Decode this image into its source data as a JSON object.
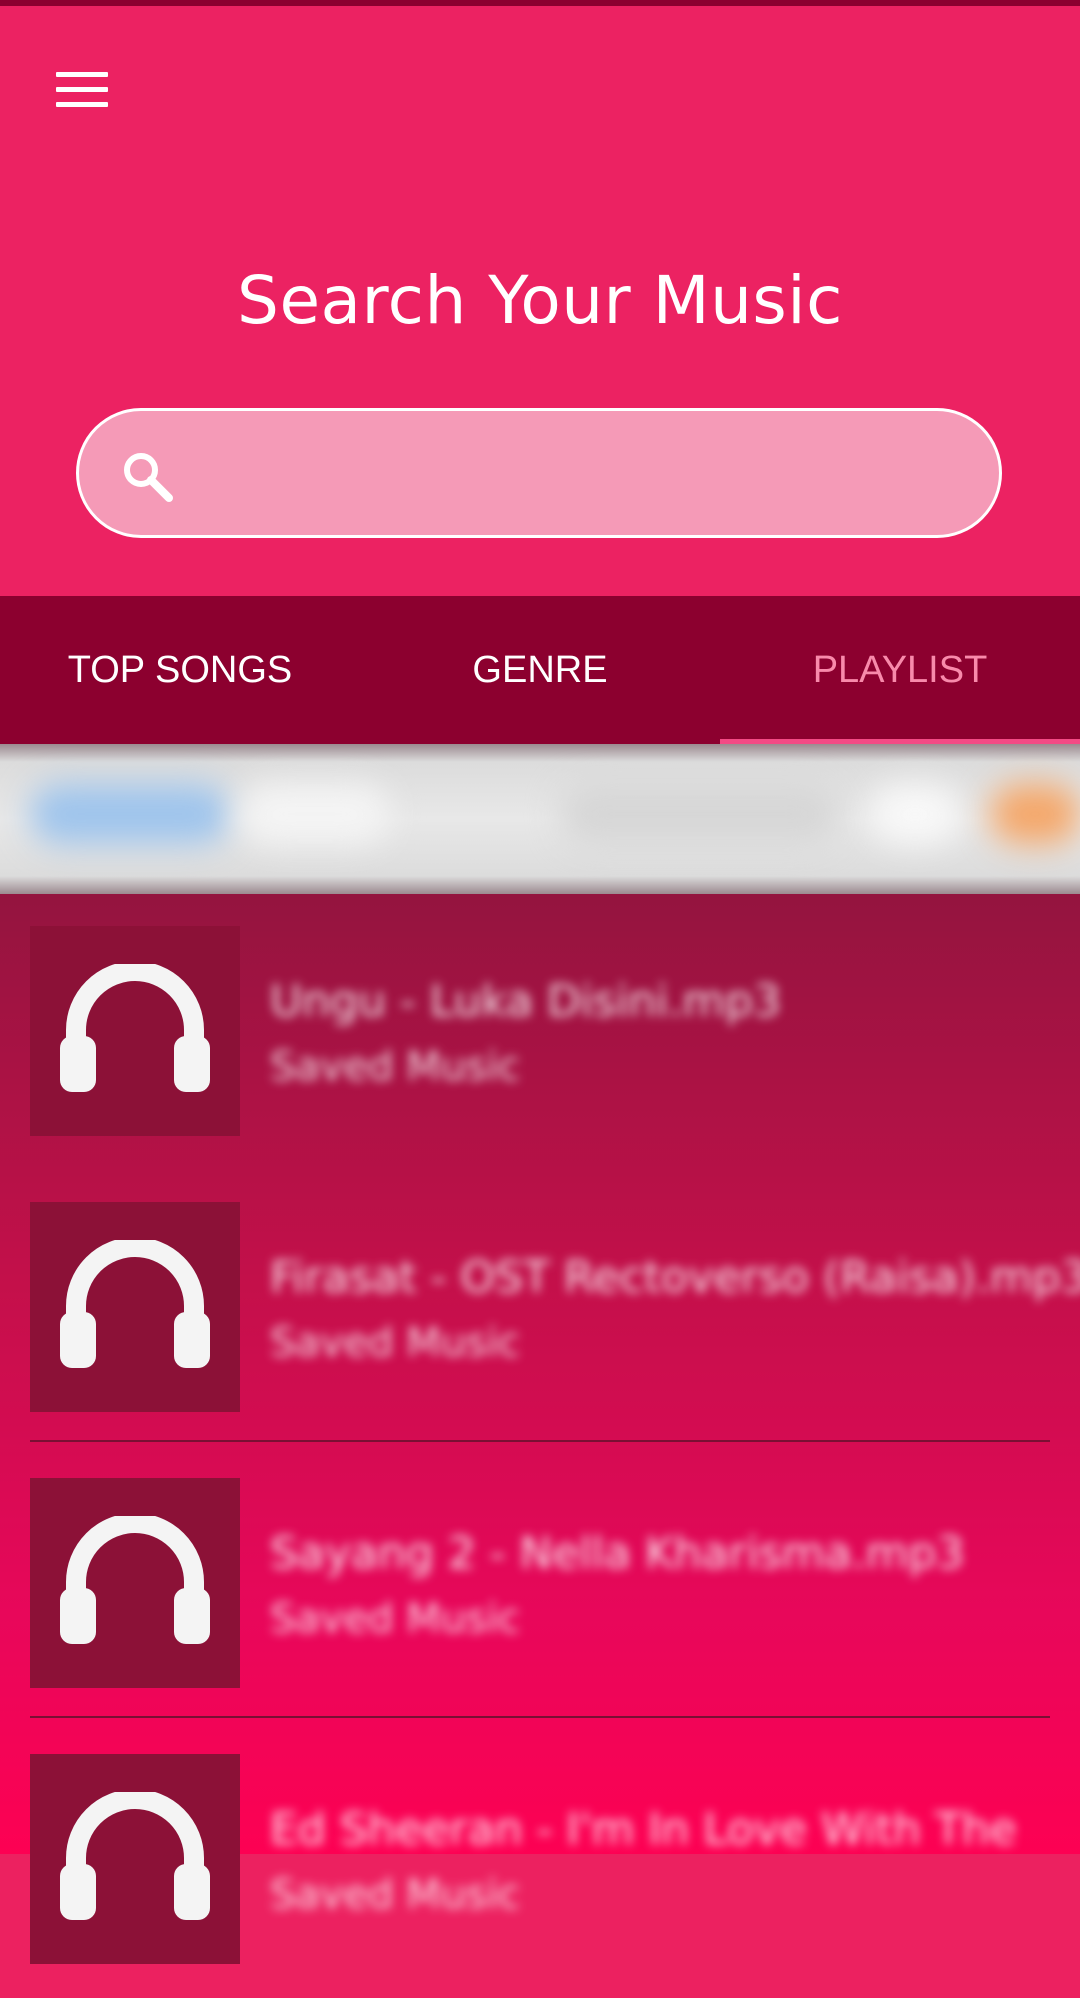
{
  "header": {
    "title": "Search Your Music",
    "search_placeholder": ""
  },
  "tabs": [
    {
      "label": "TOP SONGS",
      "active": false
    },
    {
      "label": "GENRE",
      "active": false
    },
    {
      "label": "PLAYLIST",
      "active": true
    }
  ],
  "songs": [
    {
      "title": "Ungu - Luka Disini.mp3",
      "subtitle": "Saved Music"
    },
    {
      "title": "Firasat - OST Rectoverso (Raisa).mp3",
      "subtitle": "Saved Music"
    },
    {
      "title": "Sayang 2 - Nella Kharisma.mp3",
      "subtitle": "Saved Music"
    },
    {
      "title": "Ed Sheeran - I'm In Love With The",
      "subtitle": "Saved Music"
    }
  ],
  "colors": {
    "header": "#ec2262",
    "tabs": "#8c002f",
    "active_tab": "#f88aab",
    "thumb": "#8c1137"
  }
}
